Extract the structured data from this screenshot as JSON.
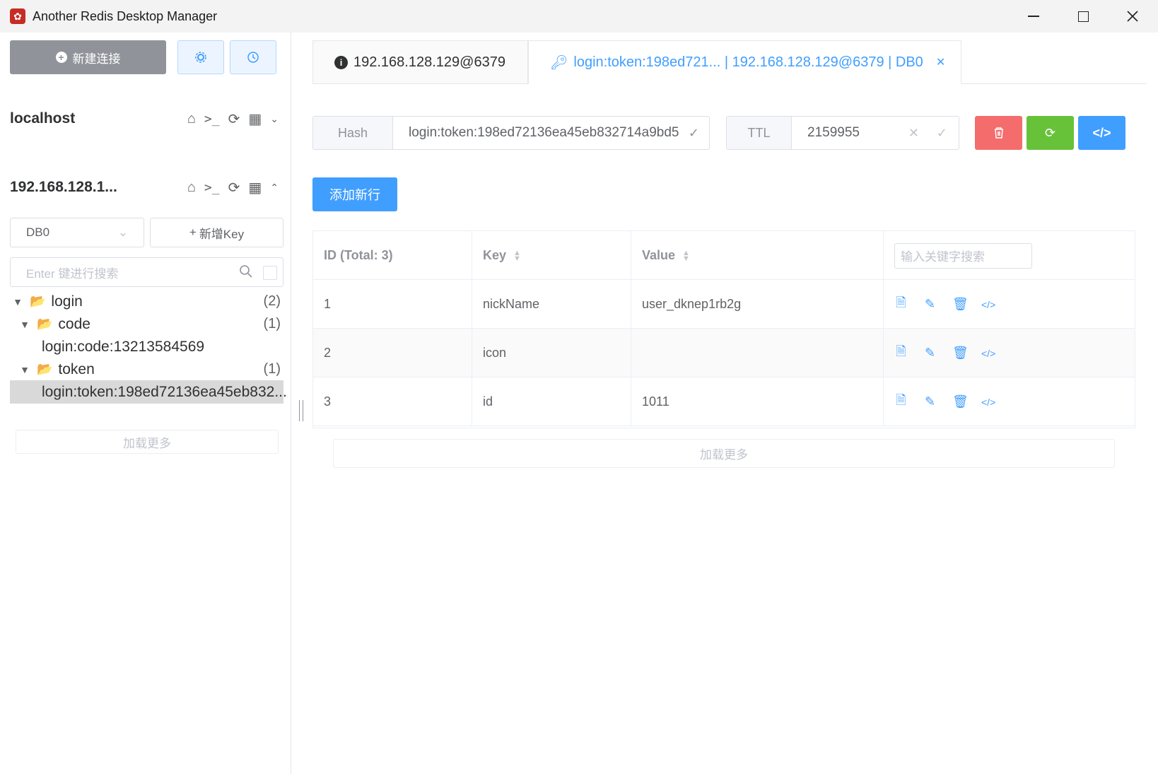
{
  "window": {
    "title": "Another Redis Desktop Manager",
    "icon": "redis-manager-logo"
  },
  "sidebar": {
    "new_connection_label": "新建连接",
    "connections": [
      {
        "name": "localhost",
        "expanded": false
      },
      {
        "name": "192.168.128.1...",
        "expanded": true
      }
    ],
    "db_select": {
      "value": "DB0"
    },
    "new_key_label": "新增Key",
    "search_placeholder": "Enter 键进行搜索",
    "tree": [
      {
        "label": "login",
        "count": "(2)",
        "type": "folder",
        "level": 0
      },
      {
        "label": "code",
        "count": "(1)",
        "type": "folder",
        "level": 1
      },
      {
        "label": "login:code:13213584569",
        "type": "key",
        "level": 2
      },
      {
        "label": "token",
        "count": "(1)",
        "type": "folder",
        "level": 1
      },
      {
        "label": "login:token:198ed72136ea45eb832...",
        "type": "key",
        "level": 2,
        "selected": true
      }
    ],
    "load_more_label": "加载更多"
  },
  "tabs": [
    {
      "label": "192.168.128.129@6379",
      "icon": "info-icon",
      "active": false
    },
    {
      "label": "login:token:198ed721... | 192.168.128.129@6379 | DB0",
      "icon": "key-icon",
      "active": true
    }
  ],
  "key_detail": {
    "type_label": "Hash",
    "key_name": "login:token:198ed72136ea45eb832714a9bd5",
    "ttl_label": "TTL",
    "ttl_value": "2159955",
    "add_row_label": "添加新行"
  },
  "table": {
    "headers": {
      "id": "ID (Total: 3)",
      "key": "Key",
      "value": "Value",
      "search_placeholder": "输入关键字搜索"
    },
    "rows": [
      {
        "id": "1",
        "key": "nickName",
        "value": "user_dknep1rb2g"
      },
      {
        "id": "2",
        "key": "icon",
        "value": ""
      },
      {
        "id": "3",
        "key": "id",
        "value": "1011"
      }
    ],
    "load_more_label": "加载更多"
  },
  "colors": {
    "primary": "#409eff",
    "danger": "#f56c6c",
    "success": "#67c23a",
    "info": "#909399"
  }
}
